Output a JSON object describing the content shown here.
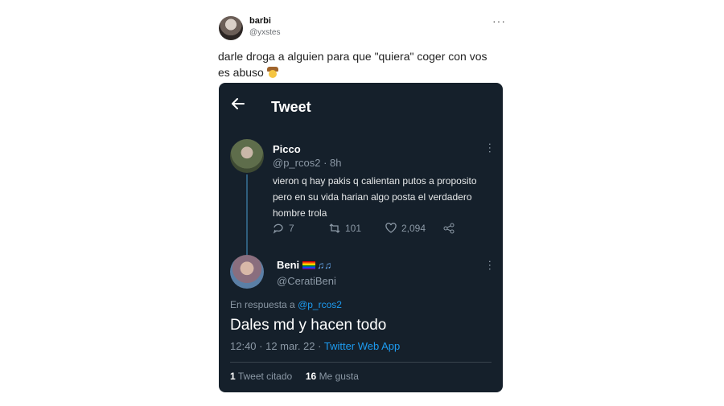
{
  "outer_tweet": {
    "author_name": "barbi",
    "author_handle": "@yxstes",
    "more": "···",
    "text_line1": "darle droga a alguien para que \"quiera\" coger con vos",
    "text_line2": "es abuso",
    "emoji": "cowboy-face-emoji"
  },
  "embedded": {
    "header_title": "Tweet",
    "original": {
      "name": "Picco",
      "handle": "@p_rcos2",
      "time": "· 8h",
      "text": "vieron q hay pakis q calientan putos a proposito pero en su vida harian algo posta el verdadero hombre trola",
      "replies": "7",
      "retweets": "101",
      "likes": "2,094"
    },
    "reply": {
      "name": "Beni",
      "handle": "@CeratiBeni",
      "reply_prefix": "En respuesta a",
      "reply_to": "@p_rcos2",
      "text": "Dales md y hacen todo",
      "timestamp": "12:40 · 12 mar. 22 ·",
      "client": "Twitter Web App",
      "quote_count": "1",
      "quote_label": "Tweet citado",
      "like_count": "16",
      "like_label": "Me gusta"
    }
  },
  "colors": {
    "card_bg": "#15202b",
    "link": "#1d9bf0",
    "muted": "#8b98a5"
  }
}
